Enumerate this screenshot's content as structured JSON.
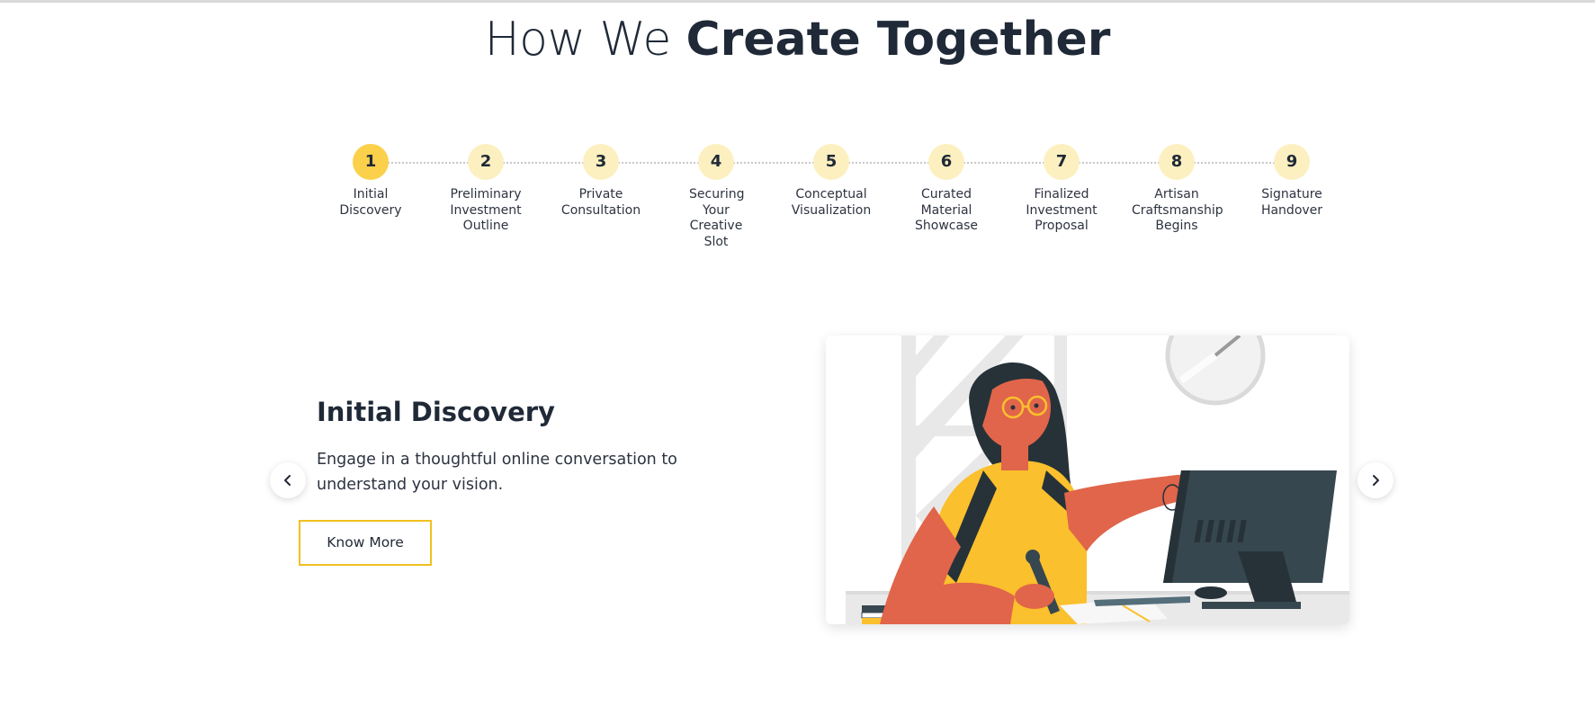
{
  "section": {
    "title_light": "How We",
    "title_bold": "Create Together"
  },
  "steps": [
    {
      "number": "1",
      "label": "Initial Discovery",
      "active": true
    },
    {
      "number": "2",
      "label": "Preliminary Investment Outline",
      "active": false
    },
    {
      "number": "3",
      "label": "Private Consultation",
      "active": false
    },
    {
      "number": "4",
      "label": "Securing Your Creative Slot",
      "active": false
    },
    {
      "number": "5",
      "label": "Conceptual Visualization",
      "active": false
    },
    {
      "number": "6",
      "label": "Curated Material Showcase",
      "active": false
    },
    {
      "number": "7",
      "label": "Finalized Investment Proposal",
      "active": false
    },
    {
      "number": "8",
      "label": "Artisan Craftsmanship Begins",
      "active": false
    },
    {
      "number": "9",
      "label": "Signature Handover",
      "active": false
    }
  ],
  "current_step": {
    "title": "Initial Discovery",
    "description": "Engage in a thoughtful online conversation to understand your vision.",
    "button_label": "Know More"
  },
  "navigation": {
    "prev_icon": "chevron-left-icon",
    "next_icon": "chevron-right-icon"
  },
  "illustration": {
    "subject": "woman-at-computer-illustration"
  },
  "colors": {
    "accent": "#fbd04a",
    "step_inactive": "#fdf0c0",
    "button_border": "#f0c021",
    "text_dark": "#1f2937"
  }
}
